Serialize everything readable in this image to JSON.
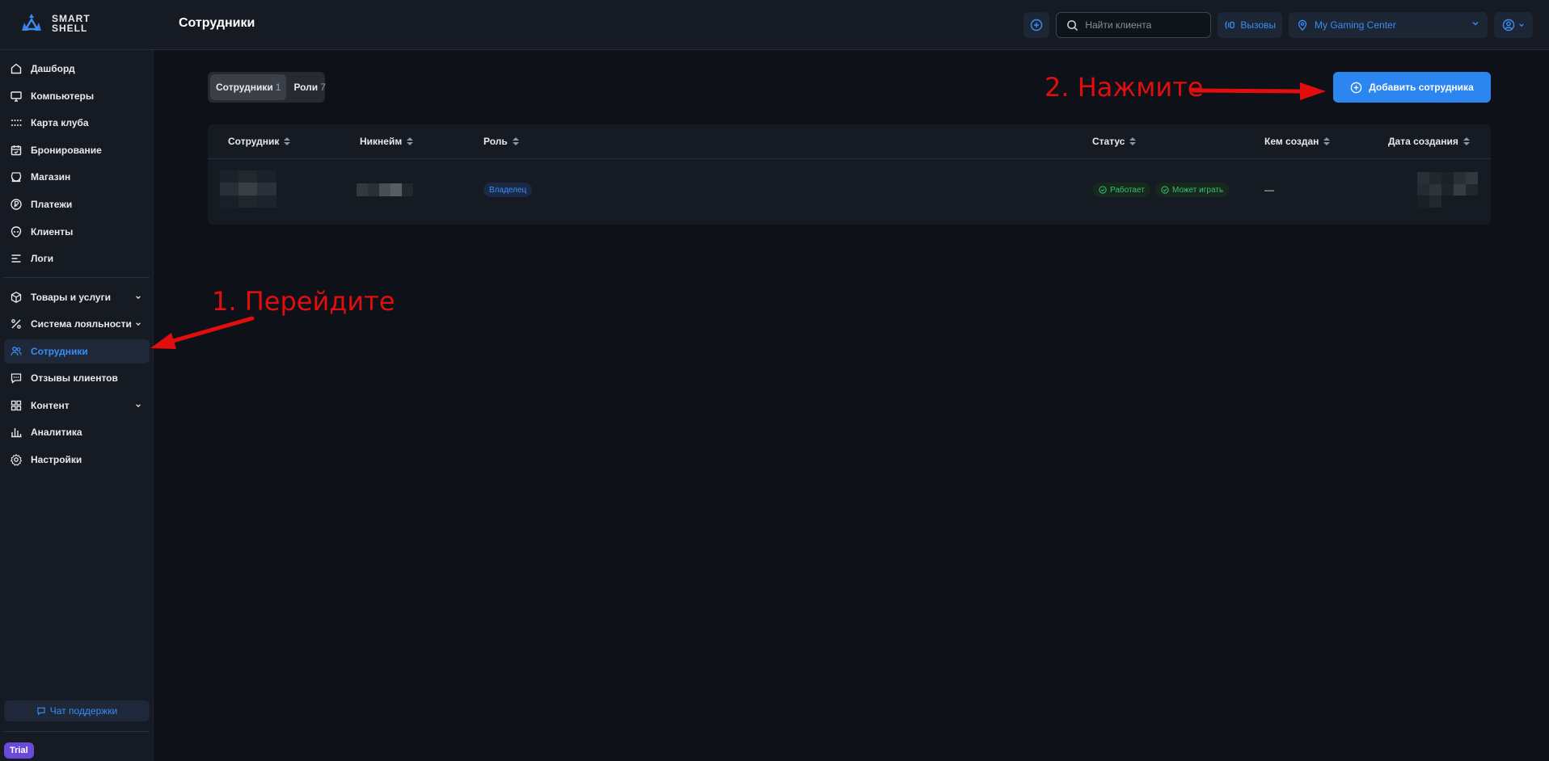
{
  "brand": {
    "line1": "SMART",
    "line2": "SHELL"
  },
  "header": {
    "title": "Сотрудники",
    "search_placeholder": "Найти клиента",
    "calls_label": "Вызовы",
    "club_name": "My Gaming Center"
  },
  "sidebar": {
    "items": [
      {
        "label": "Дашборд",
        "icon": "home-icon"
      },
      {
        "label": "Компьютеры",
        "icon": "monitor-icon"
      },
      {
        "label": "Карта клуба",
        "icon": "grid-dots-icon"
      },
      {
        "label": "Бронирование",
        "icon": "calendar-icon"
      },
      {
        "label": "Магазин",
        "icon": "store-icon"
      },
      {
        "label": "Платежи",
        "icon": "coin-icon"
      },
      {
        "label": "Клиенты",
        "icon": "alien-icon"
      },
      {
        "label": "Логи",
        "icon": "lines-icon"
      },
      {
        "label": "Товары и услуги",
        "icon": "box-icon",
        "expandable": true
      },
      {
        "label": "Система лояльности",
        "icon": "percent-icon",
        "expandable": true
      },
      {
        "label": "Сотрудники",
        "icon": "users-icon",
        "active": true
      },
      {
        "label": "Отзывы клиентов",
        "icon": "message-icon"
      },
      {
        "label": "Контент",
        "icon": "layout-icon",
        "expandable": true
      },
      {
        "label": "Аналитика",
        "icon": "chart-icon"
      },
      {
        "label": "Настройки",
        "icon": "gear-icon"
      }
    ],
    "support_label": "Чат поддержки",
    "plan_badge": "Trial"
  },
  "tabs": [
    {
      "label": "Сотрудники",
      "count": "1",
      "active": true
    },
    {
      "label": "Роли",
      "count": "7",
      "active": false
    }
  ],
  "add_button_label": "Добавить сотрудника",
  "table": {
    "columns": [
      "Сотрудник",
      "Никнейм",
      "Роль",
      "Статус",
      "Кем создан",
      "Дата создания"
    ],
    "rows": [
      {
        "role": "Владелец",
        "status_work": "Работает",
        "status_play": "Может играть",
        "created_by": "—"
      }
    ]
  },
  "annotations": {
    "step1": "1. Перейдите",
    "step2": "2. Нажмите",
    "color": "#e10e0e"
  },
  "colors": {
    "accent": "#2c86f0",
    "bg": "#0e1117",
    "panel": "#151a23",
    "success": "#3fbf6e"
  }
}
